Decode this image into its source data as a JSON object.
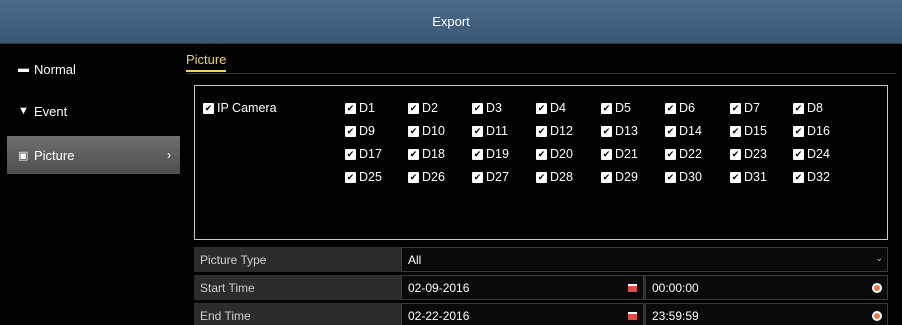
{
  "window": {
    "title": "Export"
  },
  "sidebar": {
    "items": [
      {
        "label": "Normal",
        "icon": "normal-icon"
      },
      {
        "label": "Event",
        "icon": "event-icon"
      },
      {
        "label": "Picture",
        "icon": "picture-icon",
        "active": true
      }
    ]
  },
  "tabs": [
    {
      "label": "Picture",
      "active": true
    }
  ],
  "cameras": {
    "group_label": "IP Camera",
    "group_checked": true,
    "channels": [
      "D1",
      "D2",
      "D3",
      "D4",
      "D5",
      "D6",
      "D7",
      "D8",
      "D9",
      "D10",
      "D11",
      "D12",
      "D13",
      "D14",
      "D15",
      "D16",
      "D17",
      "D18",
      "D19",
      "D20",
      "D21",
      "D22",
      "D23",
      "D24",
      "D25",
      "D26",
      "D27",
      "D28",
      "D29",
      "D30",
      "D31",
      "D32"
    ],
    "all_checked": true
  },
  "form": {
    "picture_type": {
      "label": "Picture Type",
      "value": "All"
    },
    "start_time": {
      "label": "Start Time",
      "date": "02-09-2016",
      "time": "00:00:00"
    },
    "end_time": {
      "label": "End Time",
      "date": "02-22-2016",
      "time": "23:59:59"
    }
  },
  "colors": {
    "titlebar": "#4d6a8b",
    "accent": "#f0d35a",
    "row_bg": "#2c2c2c"
  }
}
